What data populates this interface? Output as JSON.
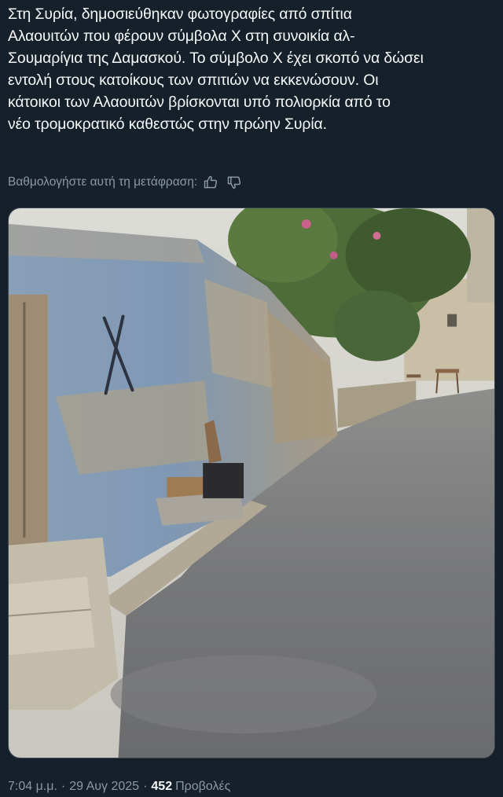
{
  "tweet": {
    "text_lines": [
      "Στη Συρία, δημοσιεύθηκαν φωτογραφίες από σπίτια",
      "Αλαουιτών που φέρουν σύμβολα Χ στη συνοικία αλ-",
      "Σουμαρίγια της Δαμασκού. Το σύμβολο Χ έχει σκοπό να δώσει",
      "εντολή στους κατοίκους των σπιτιών να εκκενώσουν. Οι",
      "κάτοικοι των Αλαουιτών βρίσκονται υπό πολιορκία από το",
      "νέο τρομοκρατικό καθεστώς στην πρώην Συρία."
    ]
  },
  "translation": {
    "rate_label": "Βαθμολογήστε αυτή τη μετάφραση:",
    "thumbs_up_icon": "thumbs-up-icon",
    "thumbs_down_icon": "thumbs-down-icon"
  },
  "media": {
    "kind": "photo",
    "painted_mark": "X"
  },
  "meta": {
    "time": "7:04 μ.μ.",
    "date": "29 Αυγ 2025",
    "separator": "·",
    "views_count": "452",
    "views_label": "Προβολές"
  },
  "colors": {
    "background": "#15202b",
    "text": "#f7f9f9",
    "secondary_text": "#8b98a5",
    "border": "#38444d"
  }
}
